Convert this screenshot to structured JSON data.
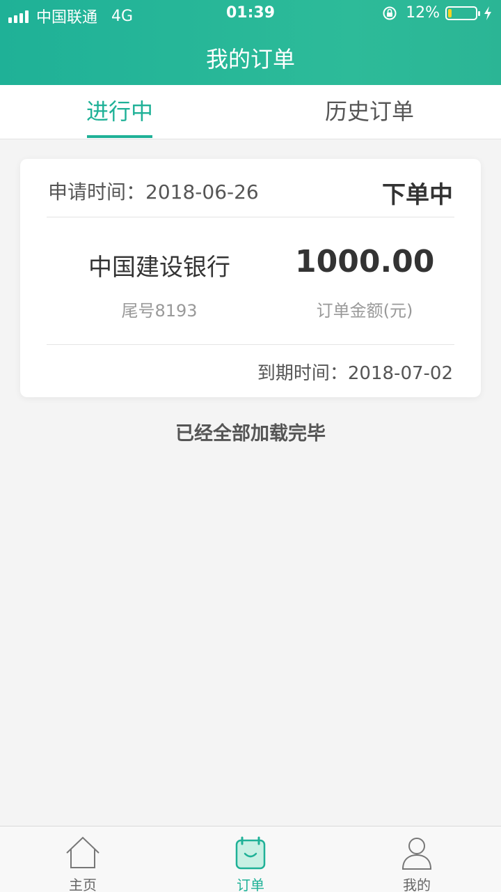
{
  "status_bar": {
    "carrier": "中国联通",
    "network": "4G",
    "time": "01:39",
    "battery_percent": "12%",
    "battery_level": 0.12,
    "icons": [
      "signal-icon",
      "rotation-lock-icon",
      "battery-icon",
      "charging-bolt-icon"
    ]
  },
  "header": {
    "title": "我的订单"
  },
  "tabs": [
    {
      "label": "进行中",
      "active": true
    },
    {
      "label": "历史订单",
      "active": false
    }
  ],
  "order": {
    "apply_label": "申请时间：",
    "apply_date": "2018-06-26",
    "status": "下单中",
    "bank_name": "中国建设银行",
    "tail_number": "尾号8193",
    "amount": "1000.00",
    "amount_label": "订单金额(元)",
    "due_label": "到期时间：",
    "due_date": "2018-07-02"
  },
  "load_status": "已经全部加载完毕",
  "bottom_nav": [
    {
      "label": "主页",
      "icon": "home-icon",
      "active": false
    },
    {
      "label": "订单",
      "icon": "order-bag-icon",
      "active": true
    },
    {
      "label": "我的",
      "icon": "user-icon",
      "active": false
    }
  ],
  "colors": {
    "accent": "#1fb197",
    "battery": "#f5d323"
  }
}
